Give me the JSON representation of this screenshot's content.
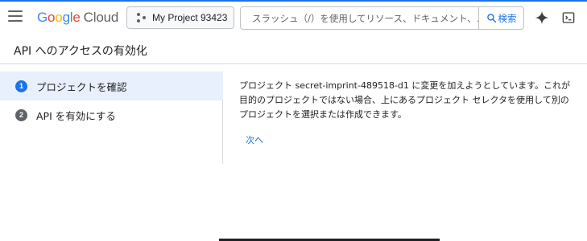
{
  "header": {
    "logo_google": "Google",
    "logo_cloud": "Cloud",
    "project_label": "My Project 93423",
    "search_placeholder": "スラッシュ（/）を使用してリソース、ドキュメント、…",
    "search_button": "検索"
  },
  "page": {
    "title": "API へのアクセスの有効化"
  },
  "steps": [
    {
      "number": "1",
      "label": "プロジェクトを確認"
    },
    {
      "number": "2",
      "label": "API を有効にする"
    }
  ],
  "content": {
    "message": "プロジェクト secret-imprint-489518-d1 に変更を加えようとしています。これが目的のプロジェクトではない場合、上にあるプロジェクト セレクタを使用して別のプロジェクトを選択または作成できます。",
    "next_label": "次へ"
  },
  "colors": {
    "accent": "#1a73e8",
    "active_step_bg": "#e8f0fe"
  }
}
